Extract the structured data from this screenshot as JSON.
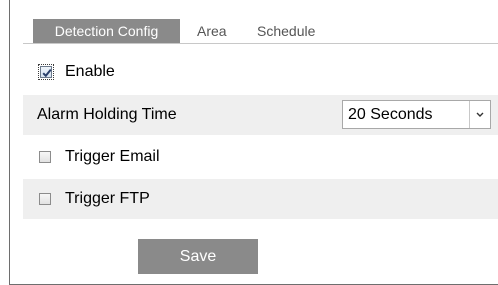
{
  "tabs": [
    {
      "label": "Detection Config",
      "active": true
    },
    {
      "label": "Area",
      "active": false
    },
    {
      "label": "Schedule",
      "active": false
    }
  ],
  "enable": {
    "label": "Enable",
    "checked": true
  },
  "alarm_holding_time": {
    "label": "Alarm Holding Time",
    "value": "20 Seconds"
  },
  "trigger_email": {
    "label": "Trigger Email",
    "checked": false
  },
  "trigger_ftp": {
    "label": "Trigger FTP",
    "checked": false
  },
  "save_button": {
    "label": "Save"
  },
  "colors": {
    "tab_active_bg": "#8a8a8a",
    "row_shade": "#efefef",
    "button_bg": "#8a8a8a"
  },
  "icons": {
    "checkbox_checked": "checkmark-icon",
    "dropdown": "chevron-down-icon"
  }
}
